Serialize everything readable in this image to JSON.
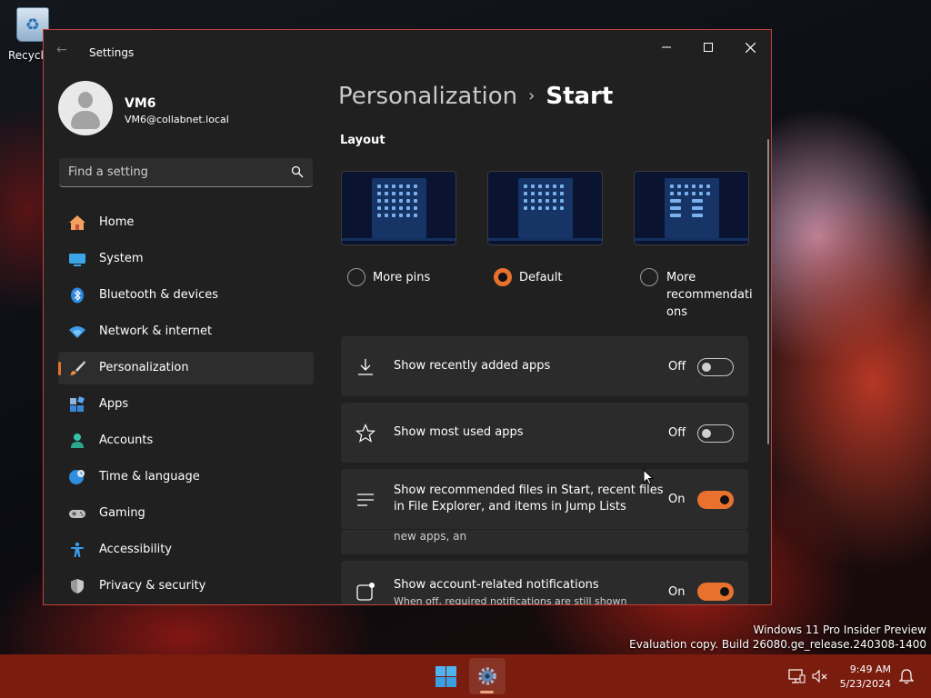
{
  "desktop": {
    "recycle_bin_label": "Recycle",
    "watermark_line1": "Windows 11 Pro Insider Preview",
    "watermark_line2": "Evaluation copy. Build 26080.ge_release.240308-1400"
  },
  "window": {
    "title": "Settings",
    "controls": [
      "minimize",
      "maximize",
      "close"
    ]
  },
  "profile": {
    "name": "VM6",
    "email": "VM6@collabnet.local"
  },
  "search": {
    "placeholder": "Find a setting"
  },
  "nav": {
    "items": [
      {
        "label": "Home",
        "icon": "home-icon"
      },
      {
        "label": "System",
        "icon": "monitor-icon"
      },
      {
        "label": "Bluetooth & devices",
        "icon": "bluetooth-icon"
      },
      {
        "label": "Network & internet",
        "icon": "wifi-icon"
      },
      {
        "label": "Personalization",
        "icon": "brush-icon",
        "selected": true
      },
      {
        "label": "Apps",
        "icon": "apps-icon"
      },
      {
        "label": "Accounts",
        "icon": "person-icon"
      },
      {
        "label": "Time & language",
        "icon": "globe-clock-icon"
      },
      {
        "label": "Gaming",
        "icon": "gamepad-icon"
      },
      {
        "label": "Accessibility",
        "icon": "accessibility-icon"
      },
      {
        "label": "Privacy & security",
        "icon": "shield-icon"
      }
    ]
  },
  "breadcrumb": {
    "parent": "Personalization",
    "separator": "›",
    "current": "Start"
  },
  "layout": {
    "heading": "Layout",
    "options": [
      {
        "label": "More pins",
        "selected": false
      },
      {
        "label": "Default",
        "selected": true
      },
      {
        "label_line1": "More",
        "label_line2": "recommendati",
        "label_line3": "ons",
        "selected": false
      }
    ]
  },
  "settings": [
    {
      "label": "Show recently added apps",
      "state": "Off",
      "on": false,
      "icon": "download-icon"
    },
    {
      "label": "Show most used apps",
      "state": "Off",
      "on": false,
      "icon": "star-icon"
    },
    {
      "label_line1": "Show recommended files in Start, recent files",
      "label_line2": "in File Explorer, and items in Jump Lists",
      "state": "On",
      "on": true,
      "icon": "list-icon"
    },
    {
      "peek_text": "new apps, an"
    },
    {
      "label": "Show account-related notifications",
      "sublabel": "When off, required notifications are still shown",
      "state": "On",
      "on": true,
      "icon": "notification-badge-icon"
    }
  ],
  "taskbar": {
    "time": "9:49 AM",
    "date": "5/23/2024"
  },
  "colors": {
    "accent": "#e8712d",
    "taskbar": "#7a1c0e",
    "window_bg": "#202020",
    "card_bg": "#2b2b2b"
  }
}
